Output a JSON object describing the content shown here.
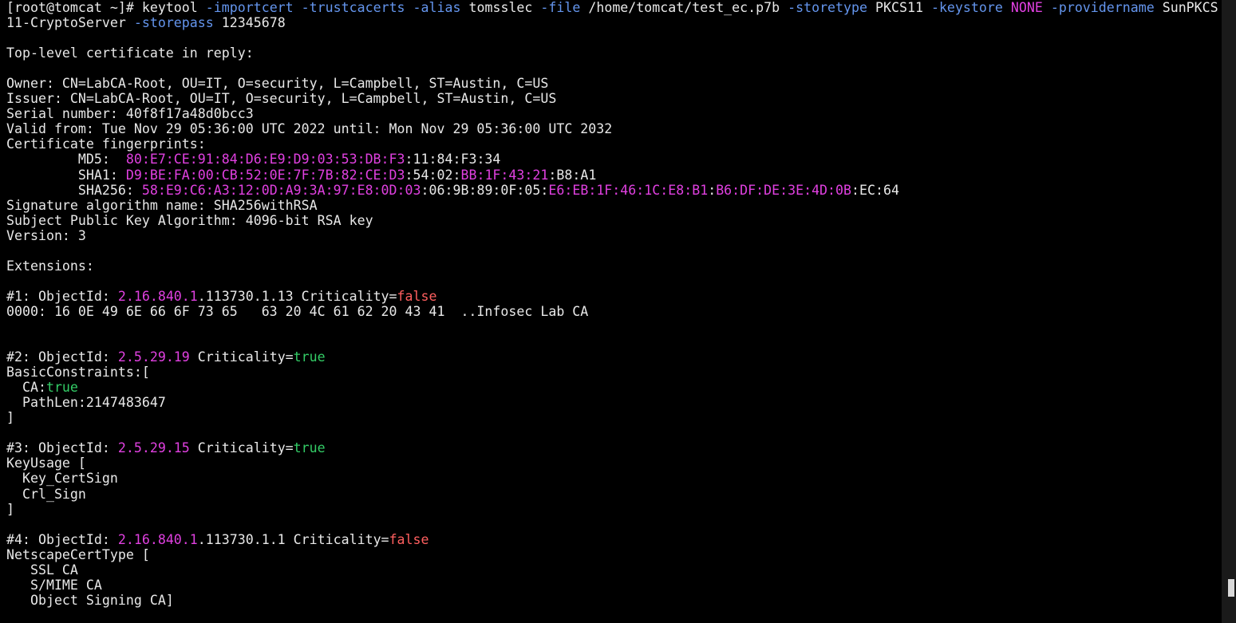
{
  "colors": {
    "background": "#000000",
    "text": "#e8e8e8",
    "option": "#6495ed",
    "magenta": "#e040e0",
    "false": "#ff5f5f",
    "true": "#33cc66"
  },
  "terminal": {
    "lines": [
      [
        {
          "t": "[root@tomcat ~]# keytool "
        },
        {
          "t": "-importcert",
          "c": "option"
        },
        {
          "t": " "
        },
        {
          "t": "-trustcacerts",
          "c": "option"
        },
        {
          "t": " "
        },
        {
          "t": "-alias",
          "c": "option"
        },
        {
          "t": " tomsslec "
        },
        {
          "t": "-file",
          "c": "option"
        },
        {
          "t": " /home/tomcat/test_ec.p7b "
        },
        {
          "t": "-storetype",
          "c": "option"
        },
        {
          "t": " PKCS11 "
        },
        {
          "t": "-keystore",
          "c": "option"
        },
        {
          "t": " "
        },
        {
          "t": "NONE",
          "c": "magenta"
        },
        {
          "t": " "
        },
        {
          "t": "-providername",
          "c": "option"
        },
        {
          "t": " SunPKCS"
        }
      ],
      [
        {
          "t": "11-CryptoServer "
        },
        {
          "t": "-storepass",
          "c": "option"
        },
        {
          "t": " 12345678"
        }
      ],
      [],
      [
        {
          "t": "Top-level certificate in reply:"
        }
      ],
      [],
      [
        {
          "t": "Owner: CN=LabCA-Root, OU=IT, O=security, L=Campbell, ST=Austin, C=US"
        }
      ],
      [
        {
          "t": "Issuer: CN=LabCA-Root, OU=IT, O=security, L=Campbell, ST=Austin, C=US"
        }
      ],
      [
        {
          "t": "Serial number: 40f8f17a48d0bcc3"
        }
      ],
      [
        {
          "t": "Valid from: Tue Nov 29 05:36:00 UTC 2022 until: Mon Nov 29 05:36:00 UTC 2032"
        }
      ],
      [
        {
          "t": "Certificate fingerprints:"
        }
      ],
      [
        {
          "t": "         MD5:  "
        },
        {
          "t": "80:E7:CE:91:84:D6:E9:D9:03:53:DB:F3",
          "c": "magenta"
        },
        {
          "t": ":11:84:F3:34"
        }
      ],
      [
        {
          "t": "         SHA1: "
        },
        {
          "t": "D9:BE:FA:00:CB:52:0E:7F:7B:82:CE:D3",
          "c": "magenta"
        },
        {
          "t": ":54:02:"
        },
        {
          "t": "BB:1F:43:21",
          "c": "magenta"
        },
        {
          "t": ":B8:A1"
        }
      ],
      [
        {
          "t": "         SHA256: "
        },
        {
          "t": "58:E9:C6:A3:12:0D:A9:3A:97:E8:0D:03",
          "c": "magenta"
        },
        {
          "t": ":06:9B:89:0F:05:"
        },
        {
          "t": "E6:EB:1F:46:1C:E8:B1",
          "c": "magenta"
        },
        {
          "t": ":"
        },
        {
          "t": "B6:DF:DE:3E:4D:0B",
          "c": "magenta"
        },
        {
          "t": ":EC:64"
        }
      ],
      [
        {
          "t": "Signature algorithm name: SHA256withRSA"
        }
      ],
      [
        {
          "t": "Subject Public Key Algorithm: 4096-bit RSA key"
        }
      ],
      [
        {
          "t": "Version: 3"
        }
      ],
      [],
      [
        {
          "t": "Extensions:"
        }
      ],
      [],
      [
        {
          "t": "#1: ObjectId: "
        },
        {
          "t": "2.16.840.1",
          "c": "magenta"
        },
        {
          "t": ".113730.1.13 Criticality="
        },
        {
          "t": "false",
          "c": "false"
        }
      ],
      [
        {
          "t": "0000: 16 0E 49 6E 66 6F 73 65   63 20 4C 61 62 20 43 41  ..Infosec Lab CA"
        }
      ],
      [],
      [],
      [
        {
          "t": "#2: ObjectId: "
        },
        {
          "t": "2.5.29.19",
          "c": "magenta"
        },
        {
          "t": " Criticality="
        },
        {
          "t": "true",
          "c": "true"
        }
      ],
      [
        {
          "t": "BasicConstraints:["
        }
      ],
      [
        {
          "t": "  CA:"
        },
        {
          "t": "true",
          "c": "true"
        }
      ],
      [
        {
          "t": "  PathLen:2147483647"
        }
      ],
      [
        {
          "t": "]"
        }
      ],
      [],
      [
        {
          "t": "#3: ObjectId: "
        },
        {
          "t": "2.5.29.15",
          "c": "magenta"
        },
        {
          "t": " Criticality="
        },
        {
          "t": "true",
          "c": "true"
        }
      ],
      [
        {
          "t": "KeyUsage ["
        }
      ],
      [
        {
          "t": "  Key_CertSign"
        }
      ],
      [
        {
          "t": "  Crl_Sign"
        }
      ],
      [
        {
          "t": "]"
        }
      ],
      [],
      [
        {
          "t": "#4: ObjectId: "
        },
        {
          "t": "2.16.840.1",
          "c": "magenta"
        },
        {
          "t": ".113730.1.1 Criticality="
        },
        {
          "t": "false",
          "c": "false"
        }
      ],
      [
        {
          "t": "NetscapeCertType ["
        }
      ],
      [
        {
          "t": "   SSL CA"
        }
      ],
      [
        {
          "t": "   S/MIME CA"
        }
      ],
      [
        {
          "t": "   Object Signing CA]"
        }
      ]
    ]
  }
}
